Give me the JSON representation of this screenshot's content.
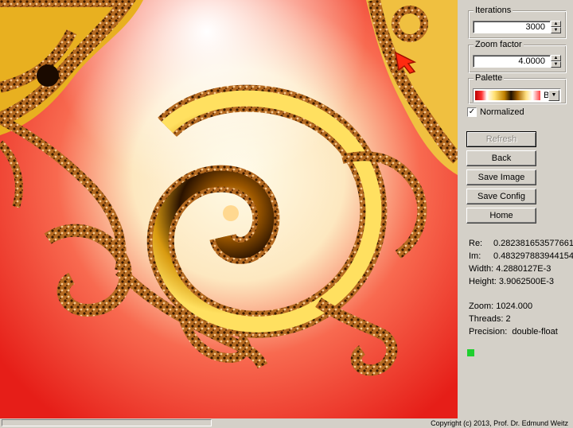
{
  "controls": {
    "iterations": {
      "label": "Iterations",
      "value": "3000"
    },
    "zoom_factor": {
      "label": "Zoom factor",
      "value": "4.0000"
    },
    "palette": {
      "label": "Palette",
      "value": "B"
    },
    "normalized": {
      "label": "Normalized",
      "checked": true
    }
  },
  "buttons": {
    "refresh": "Refresh",
    "back": "Back",
    "save_image": "Save Image",
    "save_config": "Save Config",
    "home": "Home"
  },
  "info": {
    "re": {
      "label": "Re:",
      "value": "0.282381653577661"
    },
    "im": {
      "label": "Im:",
      "value": "0.483297883944154"
    },
    "width": {
      "label": "Width:",
      "value": "4.2880127E-3"
    },
    "height": {
      "label": "Height:",
      "value": "3.9062500E-3"
    },
    "zoom": {
      "label": "Zoom:",
      "value": "1024.000"
    },
    "threads": {
      "label": "Threads:",
      "value": "2"
    },
    "precision": {
      "label": "Precision:",
      "value": "double-float"
    }
  },
  "status": {
    "indicator_color": "#1fcf2f",
    "copyright": "Copyright (c) 2013, Prof. Dr. Edmund Weitz"
  },
  "icons": {
    "spin_up": "triangle-up",
    "spin_down": "triangle-down",
    "dropdown": "triangle-down",
    "cursor": "red-arrow-icon"
  },
  "colors": {
    "fractal_background": "#e8221a",
    "fractal_gold": "#f0b020",
    "fractal_dark": "#3a1a00",
    "window_face": "#d4d0c8"
  }
}
